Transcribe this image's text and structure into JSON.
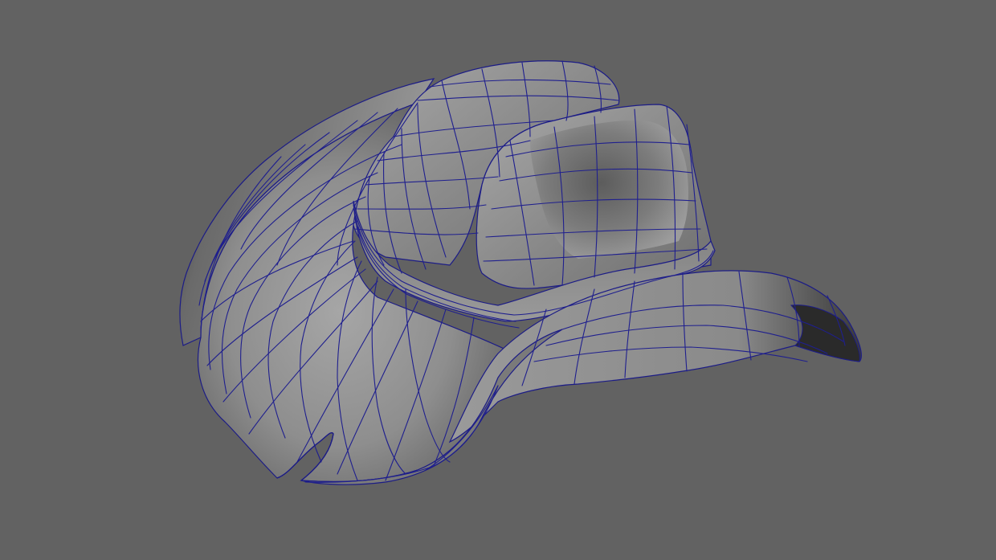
{
  "viewport": {
    "background_color": "#626262",
    "wireframe_color": "#1f1f8e",
    "surface_color": "#8c8c8c",
    "shadow_color": "#1e1e1e",
    "object_icon": "cowboy-hat-mesh-icon"
  }
}
